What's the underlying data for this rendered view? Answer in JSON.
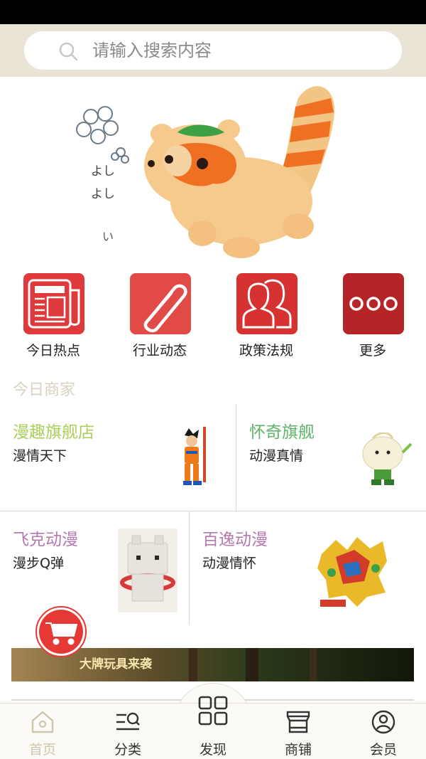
{
  "search": {
    "placeholder": "请输入搜索内容"
  },
  "banner": {
    "handwriting": [
      "よし",
      "よし",
      "い"
    ]
  },
  "quick_nav": [
    {
      "label": "今日热点",
      "icon": "newspaper-icon",
      "color": "#e0393b"
    },
    {
      "label": "行业动态",
      "icon": "paperclip-icon",
      "color": "#e24a48"
    },
    {
      "label": "政策法规",
      "icon": "people-icon",
      "color": "#d63232"
    },
    {
      "label": "更多",
      "icon": "more-dots-icon",
      "color": "#b52426"
    }
  ],
  "section": {
    "title": "今日商家"
  },
  "merchants": [
    {
      "name": "漫趣旗舰店",
      "slogan": "漫情天下",
      "name_color": "#a9cf5a"
    },
    {
      "name": "怀奇旗舰",
      "slogan": "动漫真情",
      "name_color": "#5eb567"
    },
    {
      "name": "飞克动漫",
      "slogan": "漫步Q弹",
      "name_color": "#b479ad"
    },
    {
      "name": "百逸动漫",
      "slogan": "动漫情怀",
      "name_color": "#b479ad"
    }
  ],
  "promo": {
    "text": "大牌玩具来袭"
  },
  "tabs": [
    {
      "label": "首页",
      "icon": "home-icon",
      "active": true
    },
    {
      "label": "分类",
      "icon": "category-search-icon"
    },
    {
      "label": "发现",
      "icon": "grid-icon"
    },
    {
      "label": "商铺",
      "icon": "store-icon"
    },
    {
      "label": "会员",
      "icon": "user-icon"
    }
  ],
  "colors": {
    "header_bg": "#e9e4d6",
    "accent_red": "#e53935",
    "tab_active": "#cfc6ad"
  }
}
